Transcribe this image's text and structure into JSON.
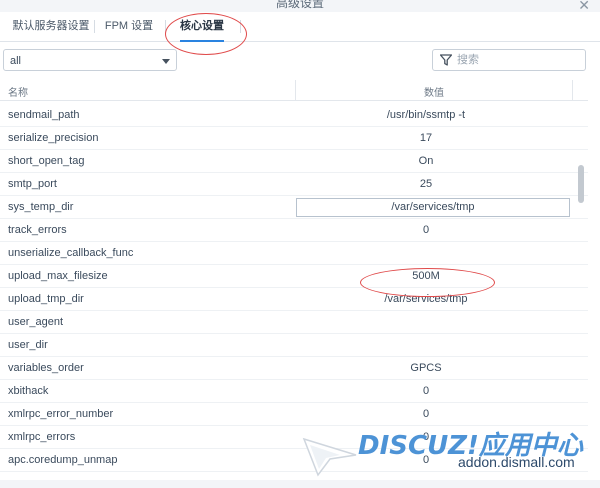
{
  "window": {
    "title": "高级设置",
    "close_icon": "close-icon"
  },
  "tabs": [
    {
      "label": "默认服务器设置",
      "active": false
    },
    {
      "label": "FPM 设置",
      "active": false
    },
    {
      "label": "核心设置",
      "active": true
    }
  ],
  "filter": {
    "select_value": "all",
    "search_placeholder": "搜索",
    "search_icon": "filter-icon"
  },
  "table": {
    "columns": [
      "名称",
      "数值"
    ],
    "rows": [
      {
        "name": "sendmail_path",
        "value": "/usr/bin/ssmtp -t"
      },
      {
        "name": "serialize_precision",
        "value": "17"
      },
      {
        "name": "short_open_tag",
        "value": "On"
      },
      {
        "name": "smtp_port",
        "value": "25"
      },
      {
        "name": "sys_temp_dir",
        "value": "/var/services/tmp"
      },
      {
        "name": "track_errors",
        "value": "0"
      },
      {
        "name": "unserialize_callback_func",
        "value": ""
      },
      {
        "name": "upload_max_filesize",
        "value": "500M"
      },
      {
        "name": "upload_tmp_dir",
        "value": "/var/services/tmp"
      },
      {
        "name": "user_agent",
        "value": ""
      },
      {
        "name": "user_dir",
        "value": ""
      },
      {
        "name": "variables_order",
        "value": "GPCS"
      },
      {
        "name": "xbithack",
        "value": "0"
      },
      {
        "name": "xmlrpc_error_number",
        "value": "0"
      },
      {
        "name": "xmlrpc_errors",
        "value": "0"
      },
      {
        "name": "apc.coredump_unmap",
        "value": "0"
      }
    ]
  },
  "watermark": {
    "logo_text": "DISCUZ!应用中心",
    "site": "addon.dismall.com"
  },
  "colors": {
    "accent": "#2a83e0",
    "annotation": "#e04a4a",
    "watermark": "#4d93d6"
  }
}
